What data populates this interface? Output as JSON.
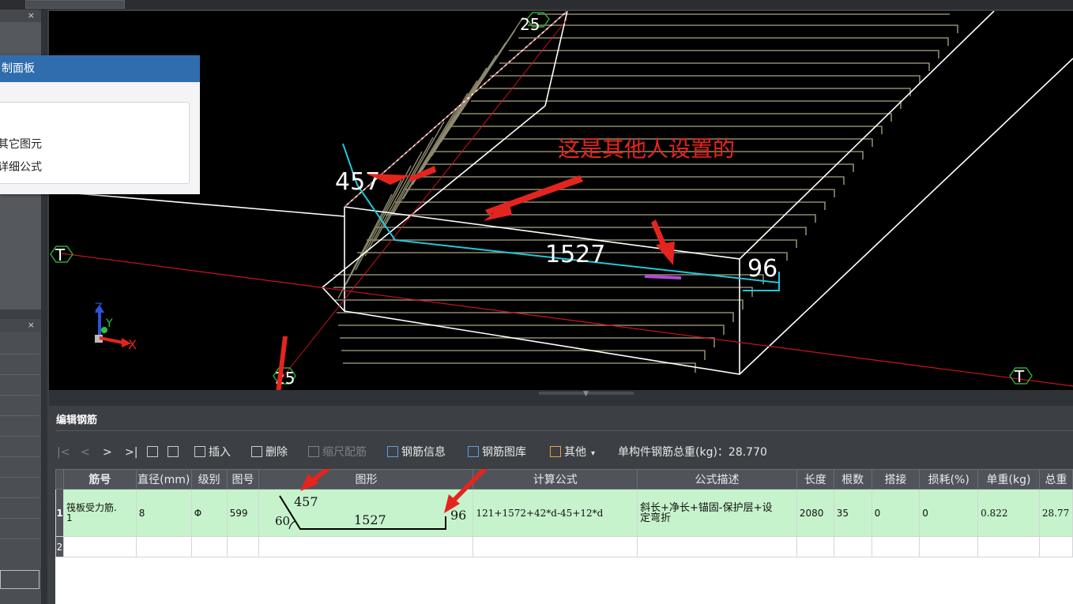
{
  "viewport": {
    "labels": {
      "top_axis": "25",
      "bottom_axis": "25",
      "axis_t_left": "T",
      "axis_t_right": "T",
      "dim_457": "457",
      "dim_1527": "1527",
      "dim_96": "96"
    },
    "annotation_text": "这是其他人设置的",
    "gizmo": {
      "z": "Z",
      "y": "Y",
      "x": "X"
    },
    "colors": {
      "background": "#000000",
      "rebar": "#21c8d9",
      "annotation": "#e4251e",
      "axis_line": "#c9151e"
    }
  },
  "left_panel": {
    "title": "制面板",
    "item_1": "其它图元",
    "item_2": "详细公式"
  },
  "editor": {
    "title": "编辑钢筋",
    "toolbar": {
      "nav_first": "|<",
      "nav_prev": "<",
      "nav_next": ">",
      "nav_last": ">|",
      "insert": "插入",
      "delete": "删除",
      "scale_config": "缩尺配筋",
      "rebar_info": "钢筋信息",
      "rebar_library": "钢筋图库",
      "other": "其他",
      "total_weight": "单构件钢筋总重(kg)：28.770"
    },
    "columns": [
      "筋号",
      "直径(mm)",
      "级别",
      "图号",
      "图形",
      "计算公式",
      "公式描述",
      "长度",
      "根数",
      "搭接",
      "损耗(%)",
      "单重(kg)",
      "总重"
    ],
    "rows": [
      {
        "row_no": "1",
        "name_line1": "筏板受力筋.",
        "name_line2": "1",
        "diameter": "8",
        "grade": "Φ",
        "fig_no": "599",
        "shape": {
          "seg1": "457",
          "angle": "60",
          "seg2": "1527",
          "seg3": "96"
        },
        "formula": "121+1572+42*d-45+12*d",
        "desc_line1": "斜长+净长+锚固-保护层+设",
        "desc_line2": "定弯折",
        "length": "2080",
        "count": "35",
        "lap": "0",
        "loss": "0",
        "unit_weight": "0.822",
        "total_weight": "28.77"
      },
      {
        "row_no": "2"
      }
    ]
  }
}
